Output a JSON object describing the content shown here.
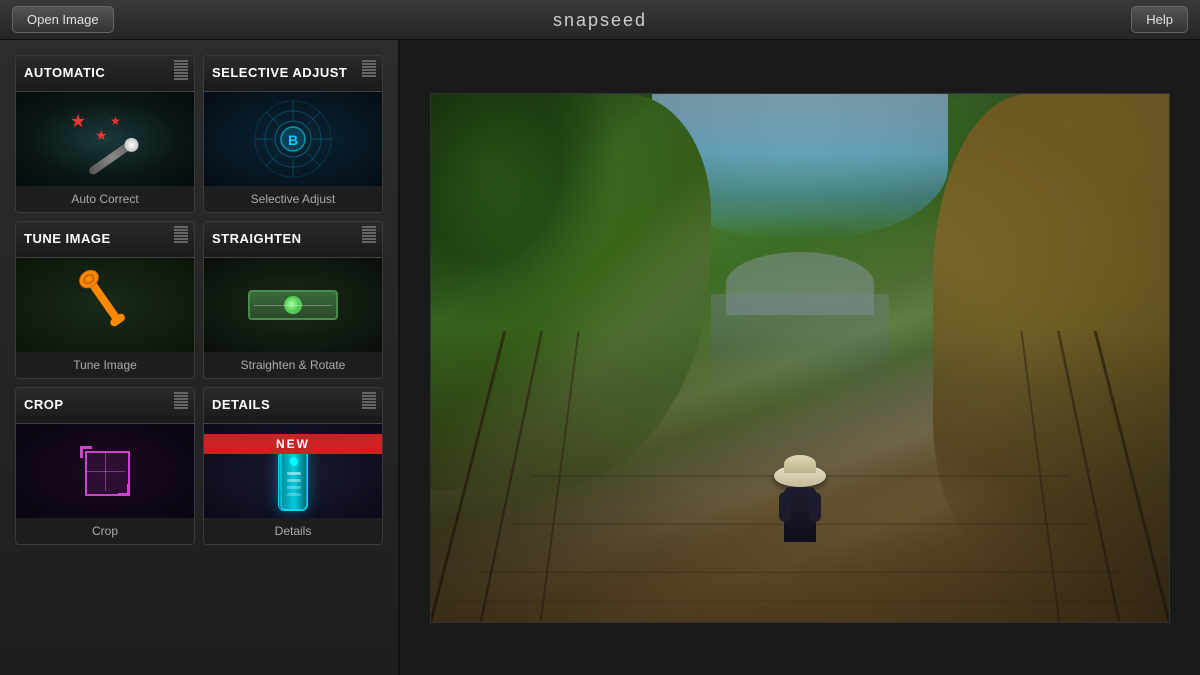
{
  "app": {
    "title": "snapseed",
    "open_image_label": "Open Image",
    "help_label": "Help"
  },
  "tools": [
    {
      "id": "auto-correct",
      "title": "AUTOMATIC",
      "label": "Auto Correct",
      "badge": null
    },
    {
      "id": "selective-adjust",
      "title": "SELECTIVE ADJUST",
      "label": "Selective Adjust",
      "badge": null
    },
    {
      "id": "tune-image",
      "title": "TUNE IMAGE",
      "label": "Tune Image",
      "badge": null
    },
    {
      "id": "straighten",
      "title": "STRAIGHTEN",
      "label": "Straighten & Rotate",
      "badge": null
    },
    {
      "id": "crop",
      "title": "CROP",
      "label": "Crop",
      "badge": null
    },
    {
      "id": "details",
      "title": "DETAILS",
      "label": "Details",
      "badge": "NEW"
    }
  ]
}
